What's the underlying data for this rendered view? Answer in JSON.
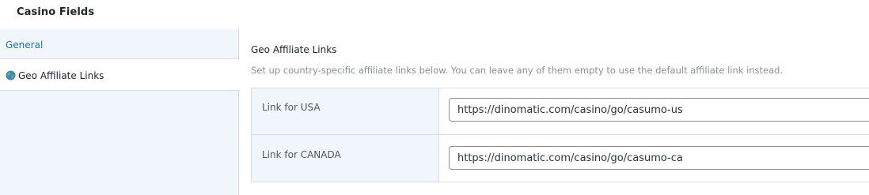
{
  "metabox": {
    "title": "Casino Fields"
  },
  "tabs": [
    {
      "label": "General",
      "active": false
    },
    {
      "label": "Geo Affiliate Links",
      "active": true,
      "icon": "globe-icon"
    }
  ],
  "section": {
    "title": "Geo Affiliate Links",
    "description": "Set up country-specific affiliate links below. You can leave any of them empty to use the default affiliate link instead."
  },
  "fields": [
    {
      "label": "Link for USA",
      "value": "https://dinomatic.com/casino/go/casumo-us"
    },
    {
      "label": "Link for CANADA",
      "value": "https://dinomatic.com/casino/go/casumo-ca"
    }
  ],
  "colors": {
    "link": "#2271b1",
    "tab_bg": "#f0f6fc",
    "border": "#dcdcde"
  }
}
